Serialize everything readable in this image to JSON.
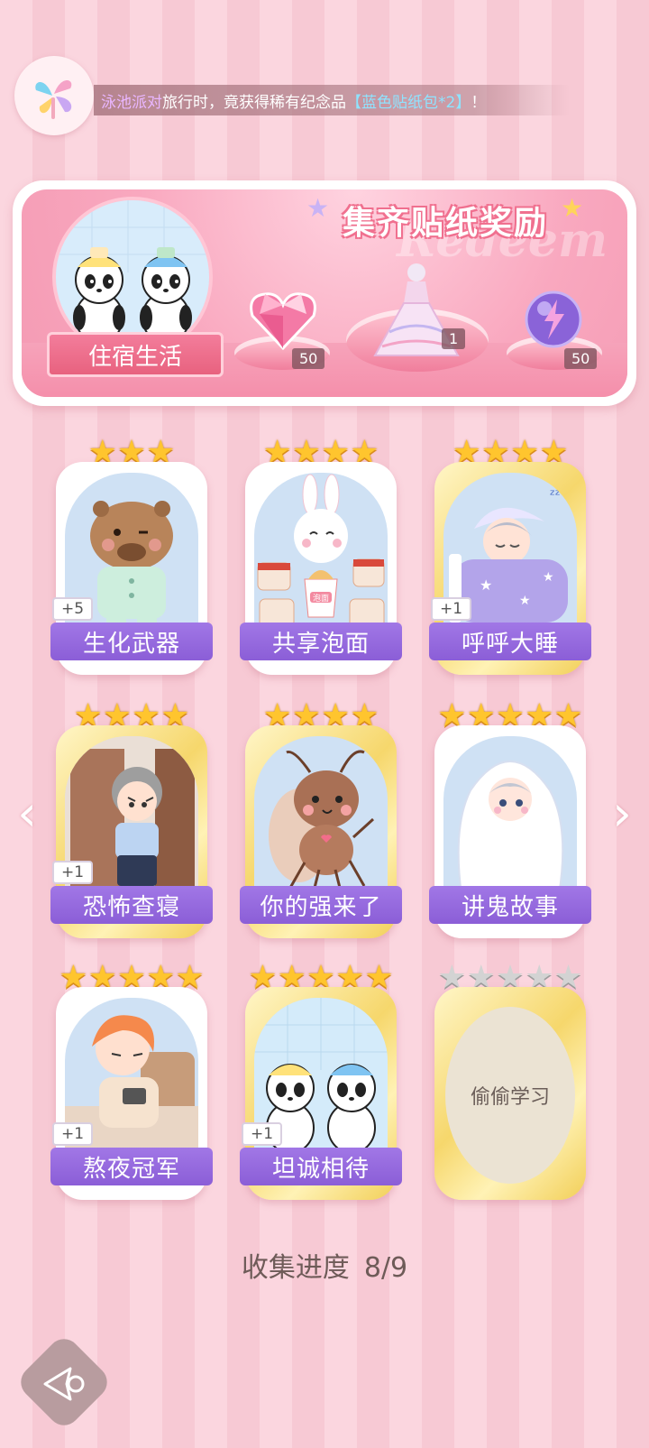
{
  "notice": {
    "place": "泳池派对",
    "text_mid": "旅行时，竟获得稀有纪念品",
    "item": "【蓝色贴纸包*2】",
    "end": "！"
  },
  "banner": {
    "title": "集齐贴纸奖励",
    "watermark": "Redeem",
    "feature_label": "住宿生活",
    "rewards": [
      {
        "icon": "pink-heart-gem-icon",
        "count": "50"
      },
      {
        "icon": "dress-costume-icon",
        "count": "1"
      },
      {
        "icon": "energy-orb-icon",
        "count": "50"
      }
    ]
  },
  "stickers": [
    {
      "name": "生化武器",
      "stars": 3,
      "bonus": "+5",
      "gold": false
    },
    {
      "name": "共享泡面",
      "stars": 4,
      "bonus": "",
      "gold": false
    },
    {
      "name": "呼呼大睡",
      "stars": 4,
      "bonus": "+1",
      "gold": true
    },
    {
      "name": "恐怖查寝",
      "stars": 4,
      "bonus": "+1",
      "gold": true
    },
    {
      "name": "你的强来了",
      "stars": 4,
      "bonus": "",
      "gold": true
    },
    {
      "name": "讲鬼故事",
      "stars": 5,
      "bonus": "",
      "gold": false
    },
    {
      "name": "熬夜冠军",
      "stars": 5,
      "bonus": "+1",
      "gold": false
    },
    {
      "name": "坦诚相待",
      "stars": 5,
      "bonus": "+1",
      "gold": true
    },
    {
      "name": "偷偷学习",
      "stars": 5,
      "bonus": "",
      "gold": true,
      "locked": true
    }
  ],
  "noodle_cup_text": "泡面",
  "progress": {
    "label": "收集进度",
    "value": "8/9"
  },
  "colors": {
    "accent_purple": "#8b5ed7",
    "accent_pink": "#f0708f",
    "star_gold": "#ffc52e"
  }
}
